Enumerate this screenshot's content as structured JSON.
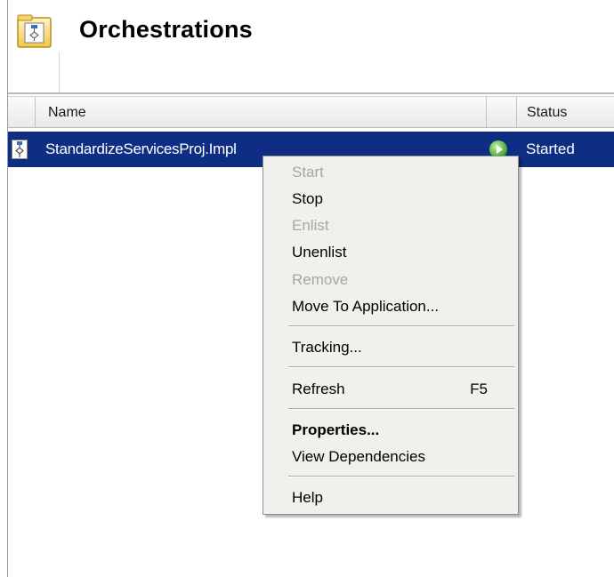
{
  "header": {
    "title": "Orchestrations",
    "icon": "orchestration-folder-icon"
  },
  "columns": {
    "name_label": "Name",
    "status_label": "Status"
  },
  "rows": [
    {
      "name": "StandardizeServicesProj.Impl",
      "status": "Started",
      "status_icon": "play-green-icon",
      "selected": true
    }
  ],
  "context_menu": {
    "items": [
      {
        "label": "Start",
        "enabled": false
      },
      {
        "label": "Stop",
        "enabled": true
      },
      {
        "label": "Enlist",
        "enabled": false
      },
      {
        "label": "Unenlist",
        "enabled": true
      },
      {
        "label": "Remove",
        "enabled": false
      },
      {
        "label": "Move To Application...",
        "enabled": true
      },
      {
        "label": "Tracking...",
        "enabled": true
      },
      {
        "label": "Refresh",
        "shortcut": "F5",
        "enabled": true
      },
      {
        "label": "Properties...",
        "enabled": true,
        "bold": true
      },
      {
        "label": "View Dependencies",
        "enabled": true
      },
      {
        "label": "Help",
        "enabled": true
      }
    ]
  },
  "colors": {
    "selection": "#0f2e83",
    "menu_background": "#f2f0ec",
    "disabled_text": "#a6a6a6"
  }
}
